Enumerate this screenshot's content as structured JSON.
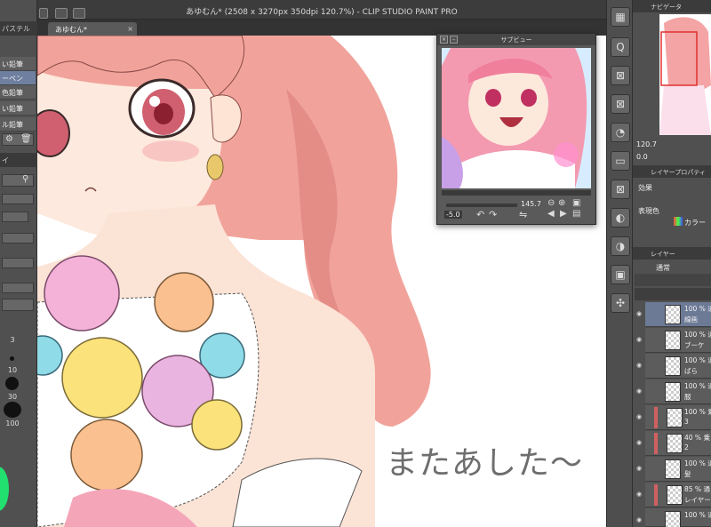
{
  "window": {
    "title": "あゆむん* (2508 x 3270px 350dpi 120.7%) - CLIP STUDIO PAINT PRO",
    "tab_label": "あゆむん*",
    "tab_close": "×"
  },
  "left_panel": {
    "header": "パステル",
    "brushes": [
      {
        "label": "い鉛筆"
      },
      {
        "label": "ーペン"
      },
      {
        "label": "色鉛筆"
      },
      {
        "label": "い鉛筆"
      },
      {
        "label": "ル鉛筆"
      }
    ],
    "side_header": "イ",
    "size_labels": [
      "3",
      "10",
      "30",
      "100"
    ]
  },
  "canvas": {
    "handwritten_text": "またあした〜"
  },
  "subview": {
    "title": "サブビュー",
    "zoom": "145.7",
    "rotation": "-5.0"
  },
  "navigator": {
    "title": "ナビゲータ",
    "zoom": "120.7",
    "rotation": "0.0"
  },
  "layer_property": {
    "title": "レイヤープロパティ",
    "effect_label": "効果",
    "expression_color_label": "表現色",
    "expression_color_value": "カラー"
  },
  "layers_panel": {
    "title": "レイヤー",
    "blend_mode": "通常",
    "layers": [
      {
        "opacity": "100 % 通",
        "name": "線画"
      },
      {
        "opacity": "100 % 通",
        "name": "ブーケ"
      },
      {
        "opacity": "100 % 通",
        "name": "ばら"
      },
      {
        "opacity": "100 % 通",
        "name": "服"
      },
      {
        "opacity": "100 % 乗",
        "name": "3"
      },
      {
        "opacity": "40 % 乗",
        "name": "2"
      },
      {
        "opacity": "100 % 通",
        "name": "髪"
      },
      {
        "opacity": "85 % 通",
        "name": "レイヤー"
      },
      {
        "opacity": "100 % 通",
        "name": ""
      }
    ]
  },
  "icons": {
    "strip": [
      "layers-icon",
      "search-icon",
      "transform-icon",
      "transform-icon",
      "brush-icon",
      "folder-icon",
      "transform-icon",
      "copy-icon",
      "mask-icon",
      "delete-icon"
    ]
  }
}
